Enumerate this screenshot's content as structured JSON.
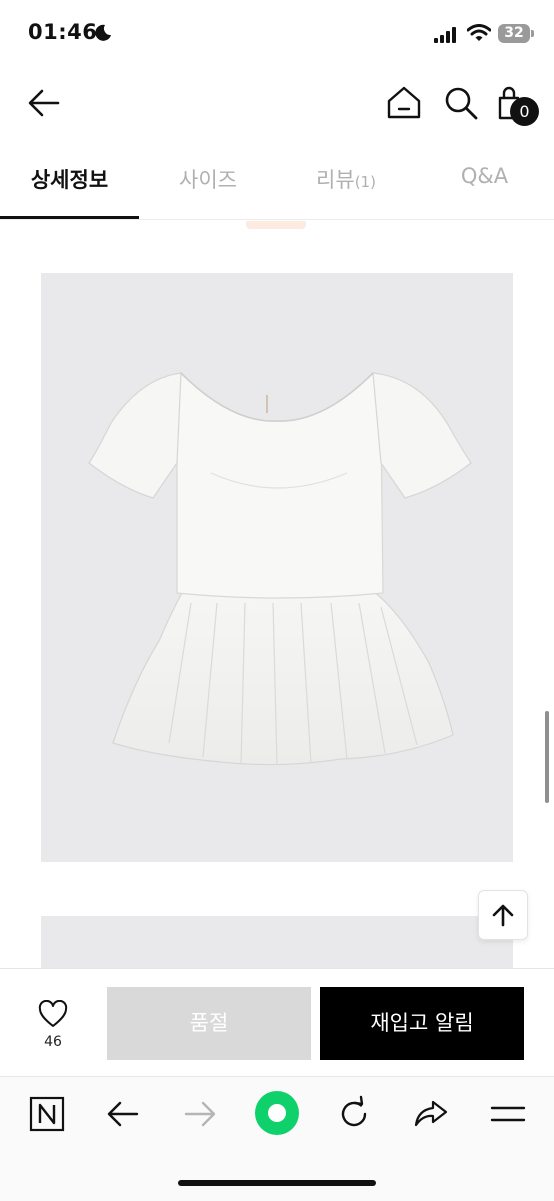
{
  "status_bar": {
    "time": "01:46",
    "battery": "32",
    "icons": [
      "moon-icon",
      "signal-icon",
      "wifi-icon",
      "battery-icon"
    ]
  },
  "header": {
    "icons": [
      "back-arrow-icon",
      "home-icon",
      "search-icon",
      "shopping-bag-icon"
    ],
    "cart_count": "0"
  },
  "tabs": [
    {
      "label": "상세정보",
      "active": true
    },
    {
      "label": "사이즈",
      "active": false
    },
    {
      "label": "리뷰",
      "count": "(1)",
      "active": false
    },
    {
      "label": "Q&A",
      "active": false
    }
  ],
  "purchase_bar": {
    "wish_count": "46",
    "soldout_label": "품절",
    "restock_label": "재입고 알림"
  },
  "browser_toolbar": {
    "icons": [
      "naver-n-icon",
      "back-icon",
      "forward-icon",
      "green-dot-icon",
      "refresh-icon",
      "share-icon",
      "menu-icon"
    ]
  },
  "colors": {
    "accent_green": "#0fd16b",
    "button_black": "#000000",
    "soldout_gray": "#d9d9d9",
    "image_bg": "#e9e9eb"
  }
}
